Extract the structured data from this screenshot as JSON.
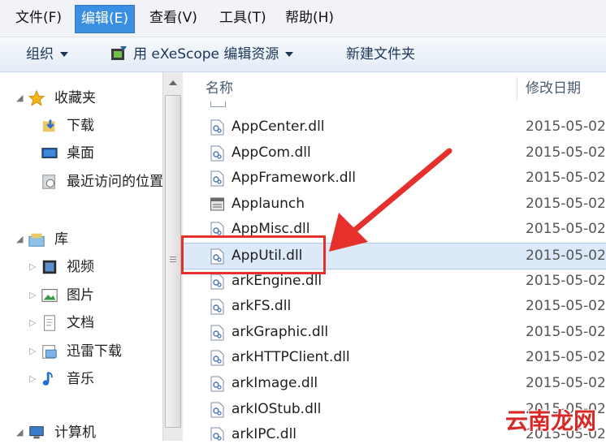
{
  "menubar": {
    "items": [
      {
        "label": "文件(F)",
        "active": false
      },
      {
        "label": "编辑(E)",
        "active": true
      },
      {
        "label": "查看(V)",
        "active": false
      },
      {
        "label": "工具(T)",
        "active": false
      },
      {
        "label": "帮助(H)",
        "active": false
      }
    ]
  },
  "toolbar": {
    "organize": "组织",
    "open_with": "用 eXeScope 编辑资源",
    "new_folder": "新建文件夹"
  },
  "nav": {
    "favorites": "收藏夹",
    "downloads": "下载",
    "desktop": "桌面",
    "recent": "最近访问的位置",
    "libraries": "库",
    "videos": "视频",
    "pictures": "图片",
    "documents": "文档",
    "xunlei": "迅雷下载",
    "music": "音乐",
    "computer": "计算机"
  },
  "columns": {
    "name": "名称",
    "date": "修改日期"
  },
  "files": [
    {
      "name": "AppCenter.dll",
      "date": "2015-05-02",
      "type": "dll"
    },
    {
      "name": "AppCom.dll",
      "date": "2015-05-02",
      "type": "dll"
    },
    {
      "name": "AppFramework.dll",
      "date": "2015-05-02",
      "type": "dll"
    },
    {
      "name": "Applaunch",
      "date": "2015-05-02",
      "type": "exe"
    },
    {
      "name": "AppMisc.dll",
      "date": "2015-05-02",
      "type": "dll"
    },
    {
      "name": "AppUtil.dll",
      "date": "2015-05-02",
      "type": "dll",
      "selected": true
    },
    {
      "name": "arkEngine.dll",
      "date": "2015-05-02",
      "type": "dll"
    },
    {
      "name": "arkFS.dll",
      "date": "2015-05-02",
      "type": "dll"
    },
    {
      "name": "arkGraphic.dll",
      "date": "2015-05-02",
      "type": "dll"
    },
    {
      "name": "arkHTTPClient.dll",
      "date": "2015-05-02",
      "type": "dll"
    },
    {
      "name": "arkImage.dll",
      "date": "2015-05-02",
      "type": "dll"
    },
    {
      "name": "arkIOStub.dll",
      "date": "2015-05-02",
      "type": "dll"
    },
    {
      "name": "arkIPC.dll",
      "date": "2015-05-02",
      "type": "dll"
    }
  ],
  "watermark": "云南龙网",
  "colors": {
    "selection": "#3a8fe0",
    "annotation": "#e6302c"
  }
}
